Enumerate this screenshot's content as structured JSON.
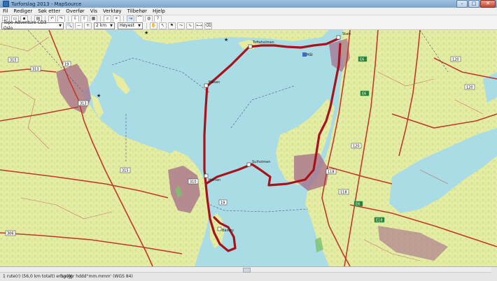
{
  "window": {
    "title": "Turforslag 2013 - MapSource",
    "minimize": "–",
    "maximize": "□",
    "close": "✕"
  },
  "menu": [
    "Fil",
    "Rediger",
    "Søk etter",
    "Overfør",
    "Vis",
    "Verktøy",
    "Tilbehør",
    "Hjelp"
  ],
  "toolbar": {
    "map_product": "Topo Adventure CD3 Oslo",
    "zoom_level": "2 km",
    "detail_level": "Høyest"
  },
  "map": {
    "waypoints": [
      "Start",
      "Tofteholmen",
      "Måken",
      "Horten",
      "Sulholmen",
      "Bastøy",
      "Mål"
    ],
    "road_labels": [
      "315",
      "313",
      "313",
      "315",
      "310",
      "19",
      "118",
      "120",
      "120",
      "118",
      "E6",
      "E6",
      "E18",
      "E6",
      "306",
      "120",
      "19"
    ],
    "colors": {
      "water": "#a9dce4",
      "land": "#e8eda0",
      "forest": "#cfe7a3",
      "route": "#a8121c",
      "roads": "#c0392b",
      "urban": "#a76a88"
    }
  },
  "status": {
    "left": "1 rute(r) (56,0 km totalt) er valgt",
    "coords": "Bgr/lgr hddd°mm.mmm' (WGS 84)"
  }
}
